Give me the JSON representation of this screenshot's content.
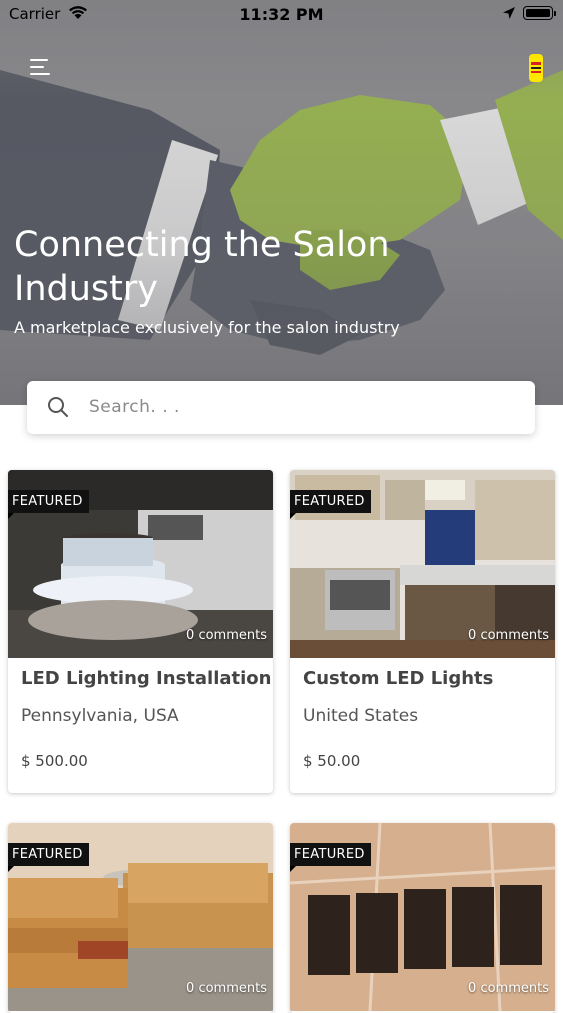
{
  "status_bar": {
    "carrier": "Carrier",
    "time": "11:32 PM"
  },
  "hero": {
    "title": "Connecting the Salon Industry",
    "subtitle": "A marketplace exclusively for the salon industry"
  },
  "search": {
    "placeholder": "Search. . ."
  },
  "listings": [
    {
      "badge": "FEATURED",
      "comments": "0 comments",
      "title": "LED Lighting Installation",
      "location": "Pennsylvania, USA",
      "price": "$ 500.00"
    },
    {
      "badge": "FEATURED",
      "comments": "0 comments",
      "title": "Custom LED Lights",
      "location": "United States",
      "price": "$ 50.00"
    },
    {
      "badge": "FEATURED",
      "comments": "0 comments"
    },
    {
      "badge": "FEATURED",
      "comments": "0 comments"
    }
  ],
  "colors": {
    "accent_green": "#9ab84a",
    "logo_yellow": "#ffe600"
  },
  "icons": [
    "menu-icon",
    "search-icon",
    "wifi-icon",
    "location-arrow-icon",
    "battery-icon",
    "app-logo-icon"
  ]
}
